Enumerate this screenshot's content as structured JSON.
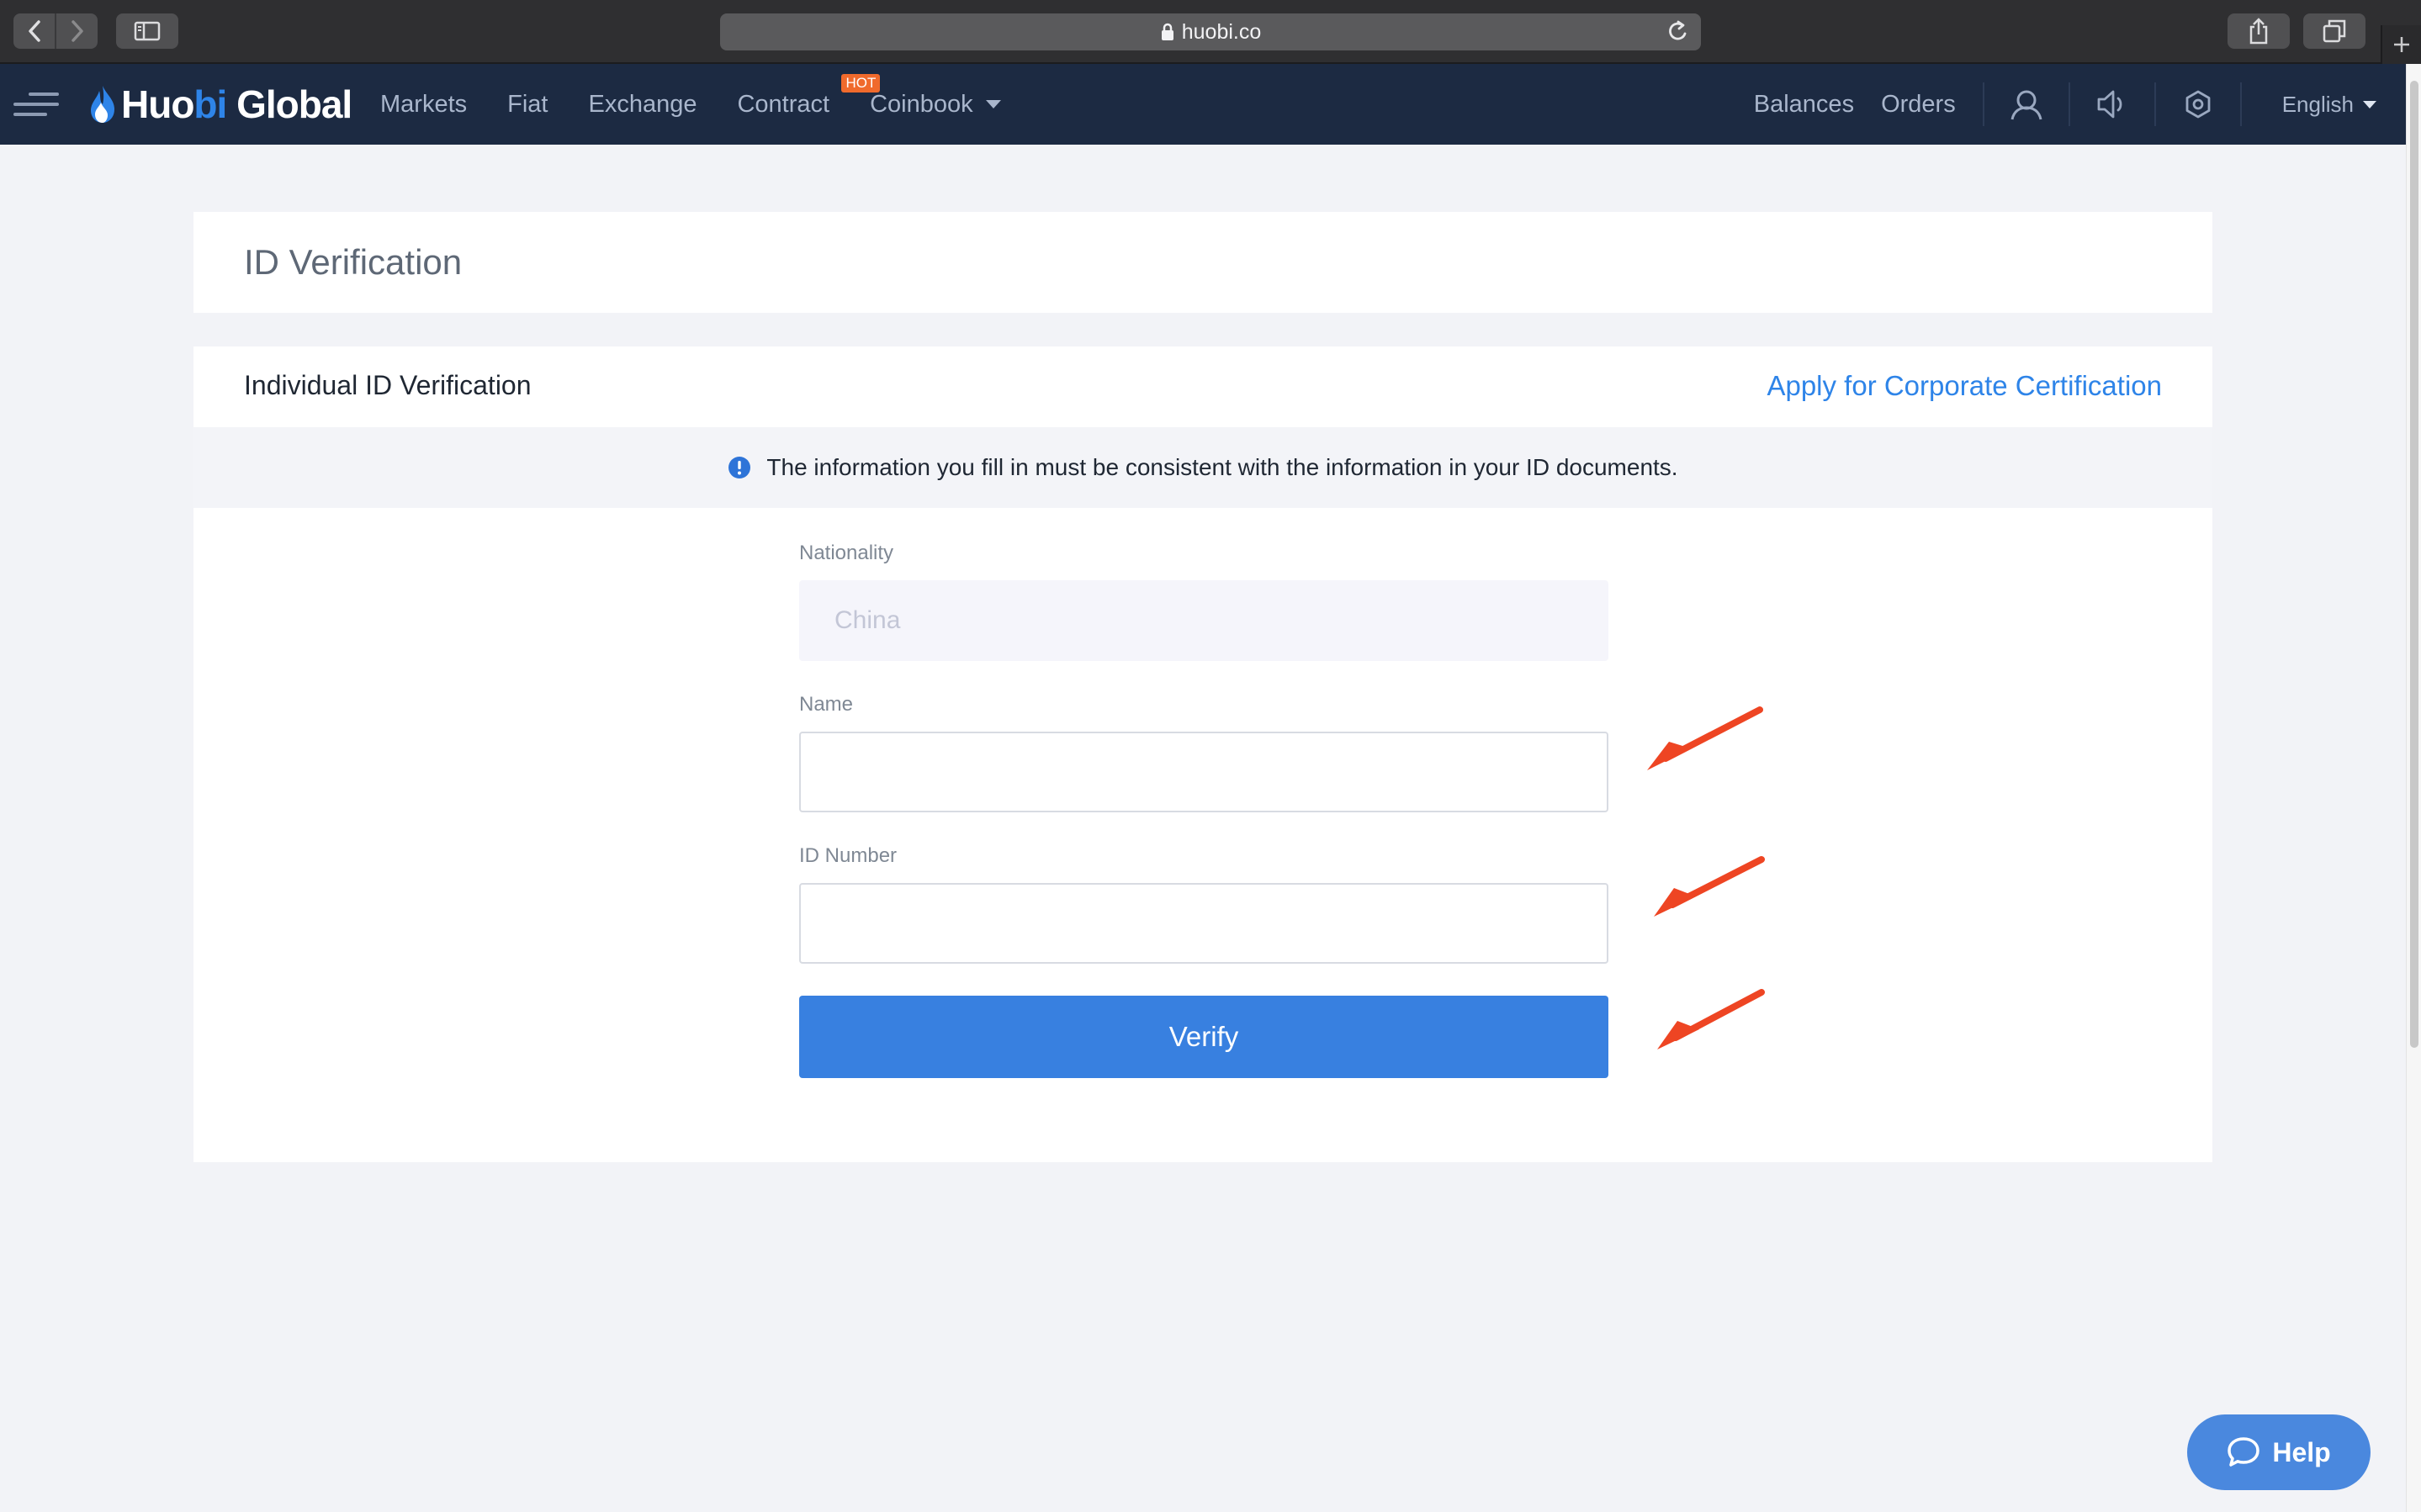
{
  "browser": {
    "url": "huobi.co"
  },
  "nav": {
    "logo_primary": "Huo",
    "logo_accent": "bi",
    "logo_secondary": "Global",
    "links": {
      "markets": "Markets",
      "fiat": "Fiat",
      "exchange": "Exchange",
      "contract": "Contract",
      "coinbook": "Coinbook"
    },
    "hot_badge": "HOT",
    "balances": "Balances",
    "orders": "Orders",
    "language": "English"
  },
  "page": {
    "title": "ID Verification"
  },
  "verification": {
    "heading": "Individual ID Verification",
    "corporate_link": "Apply for Corporate Certification",
    "notice": "The information you fill in must be consistent with the information in your ID documents.",
    "fields": {
      "nationality": {
        "label": "Nationality",
        "value": "China"
      },
      "name": {
        "label": "Name",
        "value": ""
      },
      "id_number": {
        "label": "ID Number",
        "value": ""
      }
    },
    "verify_button": "Verify"
  },
  "help": {
    "label": "Help"
  },
  "colors": {
    "nav_bg": "#1c2a42",
    "accent": "#2e84e8",
    "button": "#3880e0",
    "hot": "#f06a2c",
    "annotation_arrow": "#ee4523"
  }
}
